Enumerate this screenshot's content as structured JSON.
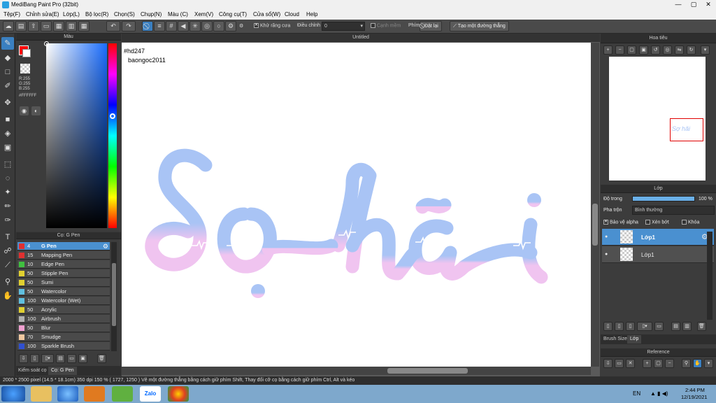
{
  "window": {
    "title": "MediBang Paint Pro (32bit)"
  },
  "menu": [
    "Tệp(F)",
    "Chỉnh sửa(E)",
    "Lớp(L)",
    "Bộ lọc(R)",
    "Chọn(S)",
    "Chụp(N)",
    "Màu (C)",
    "Xem(V)",
    "Công cụ(T)",
    "Cửa sổ(W)",
    "Cloud",
    "Help"
  ],
  "toolbar": {
    "antialias_label": "Khử răng cưa",
    "correction_label": "Điều chỉnh",
    "correction_value": "0",
    "edge_label": "Cạnh mềm",
    "shortcut_label": "Phím",
    "reset_label": "Đặt lại",
    "create_line_label": "Tạo một đường thẳng"
  },
  "color_panel": {
    "title": "Màu",
    "r": "R:255",
    "g": "G:255",
    "b": "B:255",
    "hex": "#FFFFFF",
    "fg_color": "#ff0000",
    "bg_color": "#ffffff"
  },
  "brush_panel": {
    "title": "Cọ: G Pen",
    "items": [
      {
        "size": "4",
        "name": "G Pen",
        "color": "#e03030"
      },
      {
        "size": "15",
        "name": "Mapping Pen",
        "color": "#e03030"
      },
      {
        "size": "10",
        "name": "Edge Pen",
        "color": "#40c040"
      },
      {
        "size": "50",
        "name": "Stipple Pen",
        "color": "#e0d030"
      },
      {
        "size": "50",
        "name": "Sumi",
        "color": "#e0d030"
      },
      {
        "size": "50",
        "name": "Watercolor",
        "color": "#60c0e0"
      },
      {
        "size": "100",
        "name": "Watercolor (Wet)",
        "color": "#60c0e0"
      },
      {
        "size": "50",
        "name": "Acrylic",
        "color": "#e0d030"
      },
      {
        "size": "100",
        "name": "Airbrush",
        "color": "#b0b0b0"
      },
      {
        "size": "50",
        "name": "Blur",
        "color": "#f0a0d0"
      },
      {
        "size": "70",
        "name": "Smudge",
        "color": "#f0c8a0"
      },
      {
        "size": "100",
        "name": "Sparkle Brush",
        "color": "#3050d0"
      }
    ],
    "tabs": [
      "Kiểm soát cọ",
      "Cọ: G Pen"
    ]
  },
  "canvas": {
    "title": "Untitled",
    "text_line1": "#hd247",
    "text_line2": "baongoc2011",
    "artwork_word1": "Sợ",
    "artwork_word2": "hãi",
    "colors": {
      "top": "#a9c4f5",
      "bottom": "#f0c4f0"
    }
  },
  "navigator": {
    "title": "Hoa tiêu",
    "thumb_text": "Sợ hãi"
  },
  "layer_panel": {
    "title": "Lớp",
    "opacity_label": "Độ trong",
    "opacity_value": "100 %",
    "opacity_percent": 100,
    "blend_label": "Pha trộn",
    "blend_value": "Bình thường",
    "protect_alpha": "Bảo vệ alpha",
    "clipping": "Xén bớt",
    "lock": "Khóa",
    "layers": [
      {
        "name": "Lớp1",
        "selected": true
      },
      {
        "name": "Lớp1",
        "selected": false
      }
    ],
    "tabs": [
      "Brush Size",
      "Lớp"
    ]
  },
  "reference": {
    "title": "Reference"
  },
  "status": {
    "text": "2000 * 2500 pixel  (14.5 * 18.1cm)  350 dpi  150 %  ( 1727, 1250 )  Vẽ một đường thẳng bằng cách giữ phím Shift, Thay đổi cỡ cọ bằng cách giữ phím Ctrl, Alt và kéo"
  },
  "taskbar": {
    "lang": "EN",
    "time": "2:44 PM",
    "date": "12/19/2021",
    "zalo": "Zalo"
  }
}
